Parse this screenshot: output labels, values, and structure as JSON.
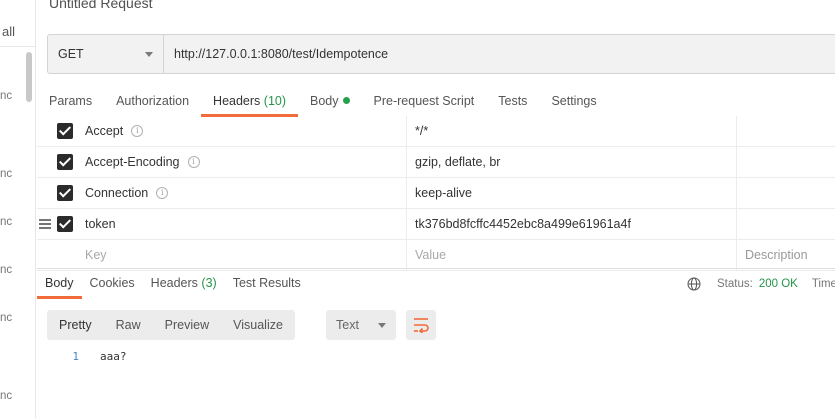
{
  "sidebar": {
    "all_label": "all",
    "fragments": [
      "nc",
      "nc",
      "nc",
      "nc",
      "nc",
      "nc"
    ]
  },
  "request": {
    "title": "Untitled Request",
    "method": "GET",
    "url": "http://127.0.0.1:8080/test/Idempotence"
  },
  "request_tabs": [
    {
      "label": "Params"
    },
    {
      "label": "Authorization"
    },
    {
      "label": "Headers",
      "count": "(10)",
      "active": true
    },
    {
      "label": "Body",
      "indicator": "green-dot"
    },
    {
      "label": "Pre-request Script"
    },
    {
      "label": "Tests"
    },
    {
      "label": "Settings"
    }
  ],
  "headers": [
    {
      "key": "Accept",
      "value": "*/*",
      "checked": true,
      "info_icon": true
    },
    {
      "key": "Accept-Encoding",
      "value": "gzip, deflate, br",
      "checked": true,
      "info_icon": true
    },
    {
      "key": "Connection",
      "value": "keep-alive",
      "checked": true,
      "info_icon": true
    },
    {
      "key": "token",
      "value": "tk376bd8fcffc4452ebc8a499e61961a4f",
      "checked": true,
      "info_icon": false
    }
  ],
  "headers_new_row": {
    "key_placeholder": "Key",
    "value_placeholder": "Value",
    "description_placeholder": "Description"
  },
  "response_tabs": [
    {
      "label": "Body",
      "active": true
    },
    {
      "label": "Cookies"
    },
    {
      "label": "Headers",
      "count": "(3)"
    },
    {
      "label": "Test Results"
    }
  ],
  "response_status": {
    "status_label": "Status:",
    "status_value": "200 OK",
    "time_label": "Time"
  },
  "view_modes": [
    "Pretty",
    "Raw",
    "Preview",
    "Visualize"
  ],
  "format": "Text",
  "body_lines": [
    {
      "line": "1",
      "text": "aaa?"
    }
  ],
  "colors": {
    "accent_orange": "#f26b3a",
    "status_green": "#24954a"
  }
}
